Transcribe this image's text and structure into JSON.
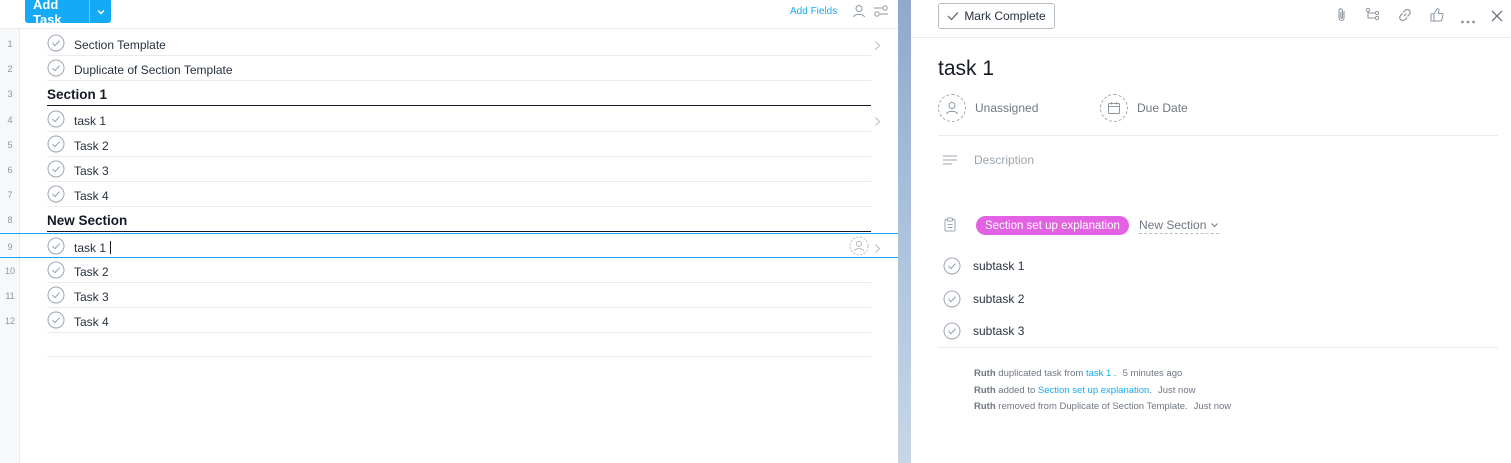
{
  "toolbar": {
    "add_task_label": "Add Task",
    "add_fields_label": "Add Fields"
  },
  "rows": [
    {
      "num": "1",
      "type": "task",
      "name": "Section Template",
      "chevron": true
    },
    {
      "num": "2",
      "type": "task",
      "name": "Duplicate of Section Template"
    },
    {
      "num": "3",
      "type": "section",
      "name": "Section 1"
    },
    {
      "num": "4",
      "type": "task",
      "name": "task 1",
      "chevron": true
    },
    {
      "num": "5",
      "type": "task",
      "name": "Task 2"
    },
    {
      "num": "6",
      "type": "task",
      "name": "Task 3"
    },
    {
      "num": "7",
      "type": "task",
      "name": "Task 4"
    },
    {
      "num": "8",
      "type": "section",
      "name": "New Section"
    },
    {
      "num": "9",
      "type": "task",
      "name": "task 1",
      "selected": true,
      "chevron": true
    },
    {
      "num": "10",
      "type": "task",
      "name": "Task 2"
    },
    {
      "num": "11",
      "type": "task",
      "name": "Task 3"
    },
    {
      "num": "12",
      "type": "task",
      "name": "Task 4"
    }
  ],
  "detail": {
    "mark_complete_label": "Mark Complete",
    "title": "task 1",
    "assignee": "Unassigned",
    "due_date": "Due Date",
    "description_placeholder": "Description",
    "project": "Section set up explanation",
    "section": "New Section",
    "subtasks": [
      "subtask 1",
      "subtask 2",
      "subtask 3"
    ],
    "stories": [
      {
        "user": "Ruth",
        "text": " duplicated task from ",
        "link": "task 1",
        "after": " .",
        "time": "5 minutes ago"
      },
      {
        "user": "Ruth",
        "text": " added to ",
        "link": "Section set up explanation",
        "after": ".",
        "time": "Just now"
      },
      {
        "user": "Ruth",
        "text": " removed from Duplicate of Section Template.",
        "link": "",
        "after": "",
        "time": "Just now"
      }
    ]
  },
  "colors": {
    "accent": "#14aaf5",
    "project_pill": "#e362e3",
    "section_rule": "#151b26"
  },
  "icons": {
    "toolbar": [
      "person-icon",
      "filter-icon"
    ],
    "detail_toolbar": [
      "attachment-icon",
      "subtask-icon",
      "link-icon",
      "like-icon",
      "more-icon",
      "close-icon"
    ]
  }
}
